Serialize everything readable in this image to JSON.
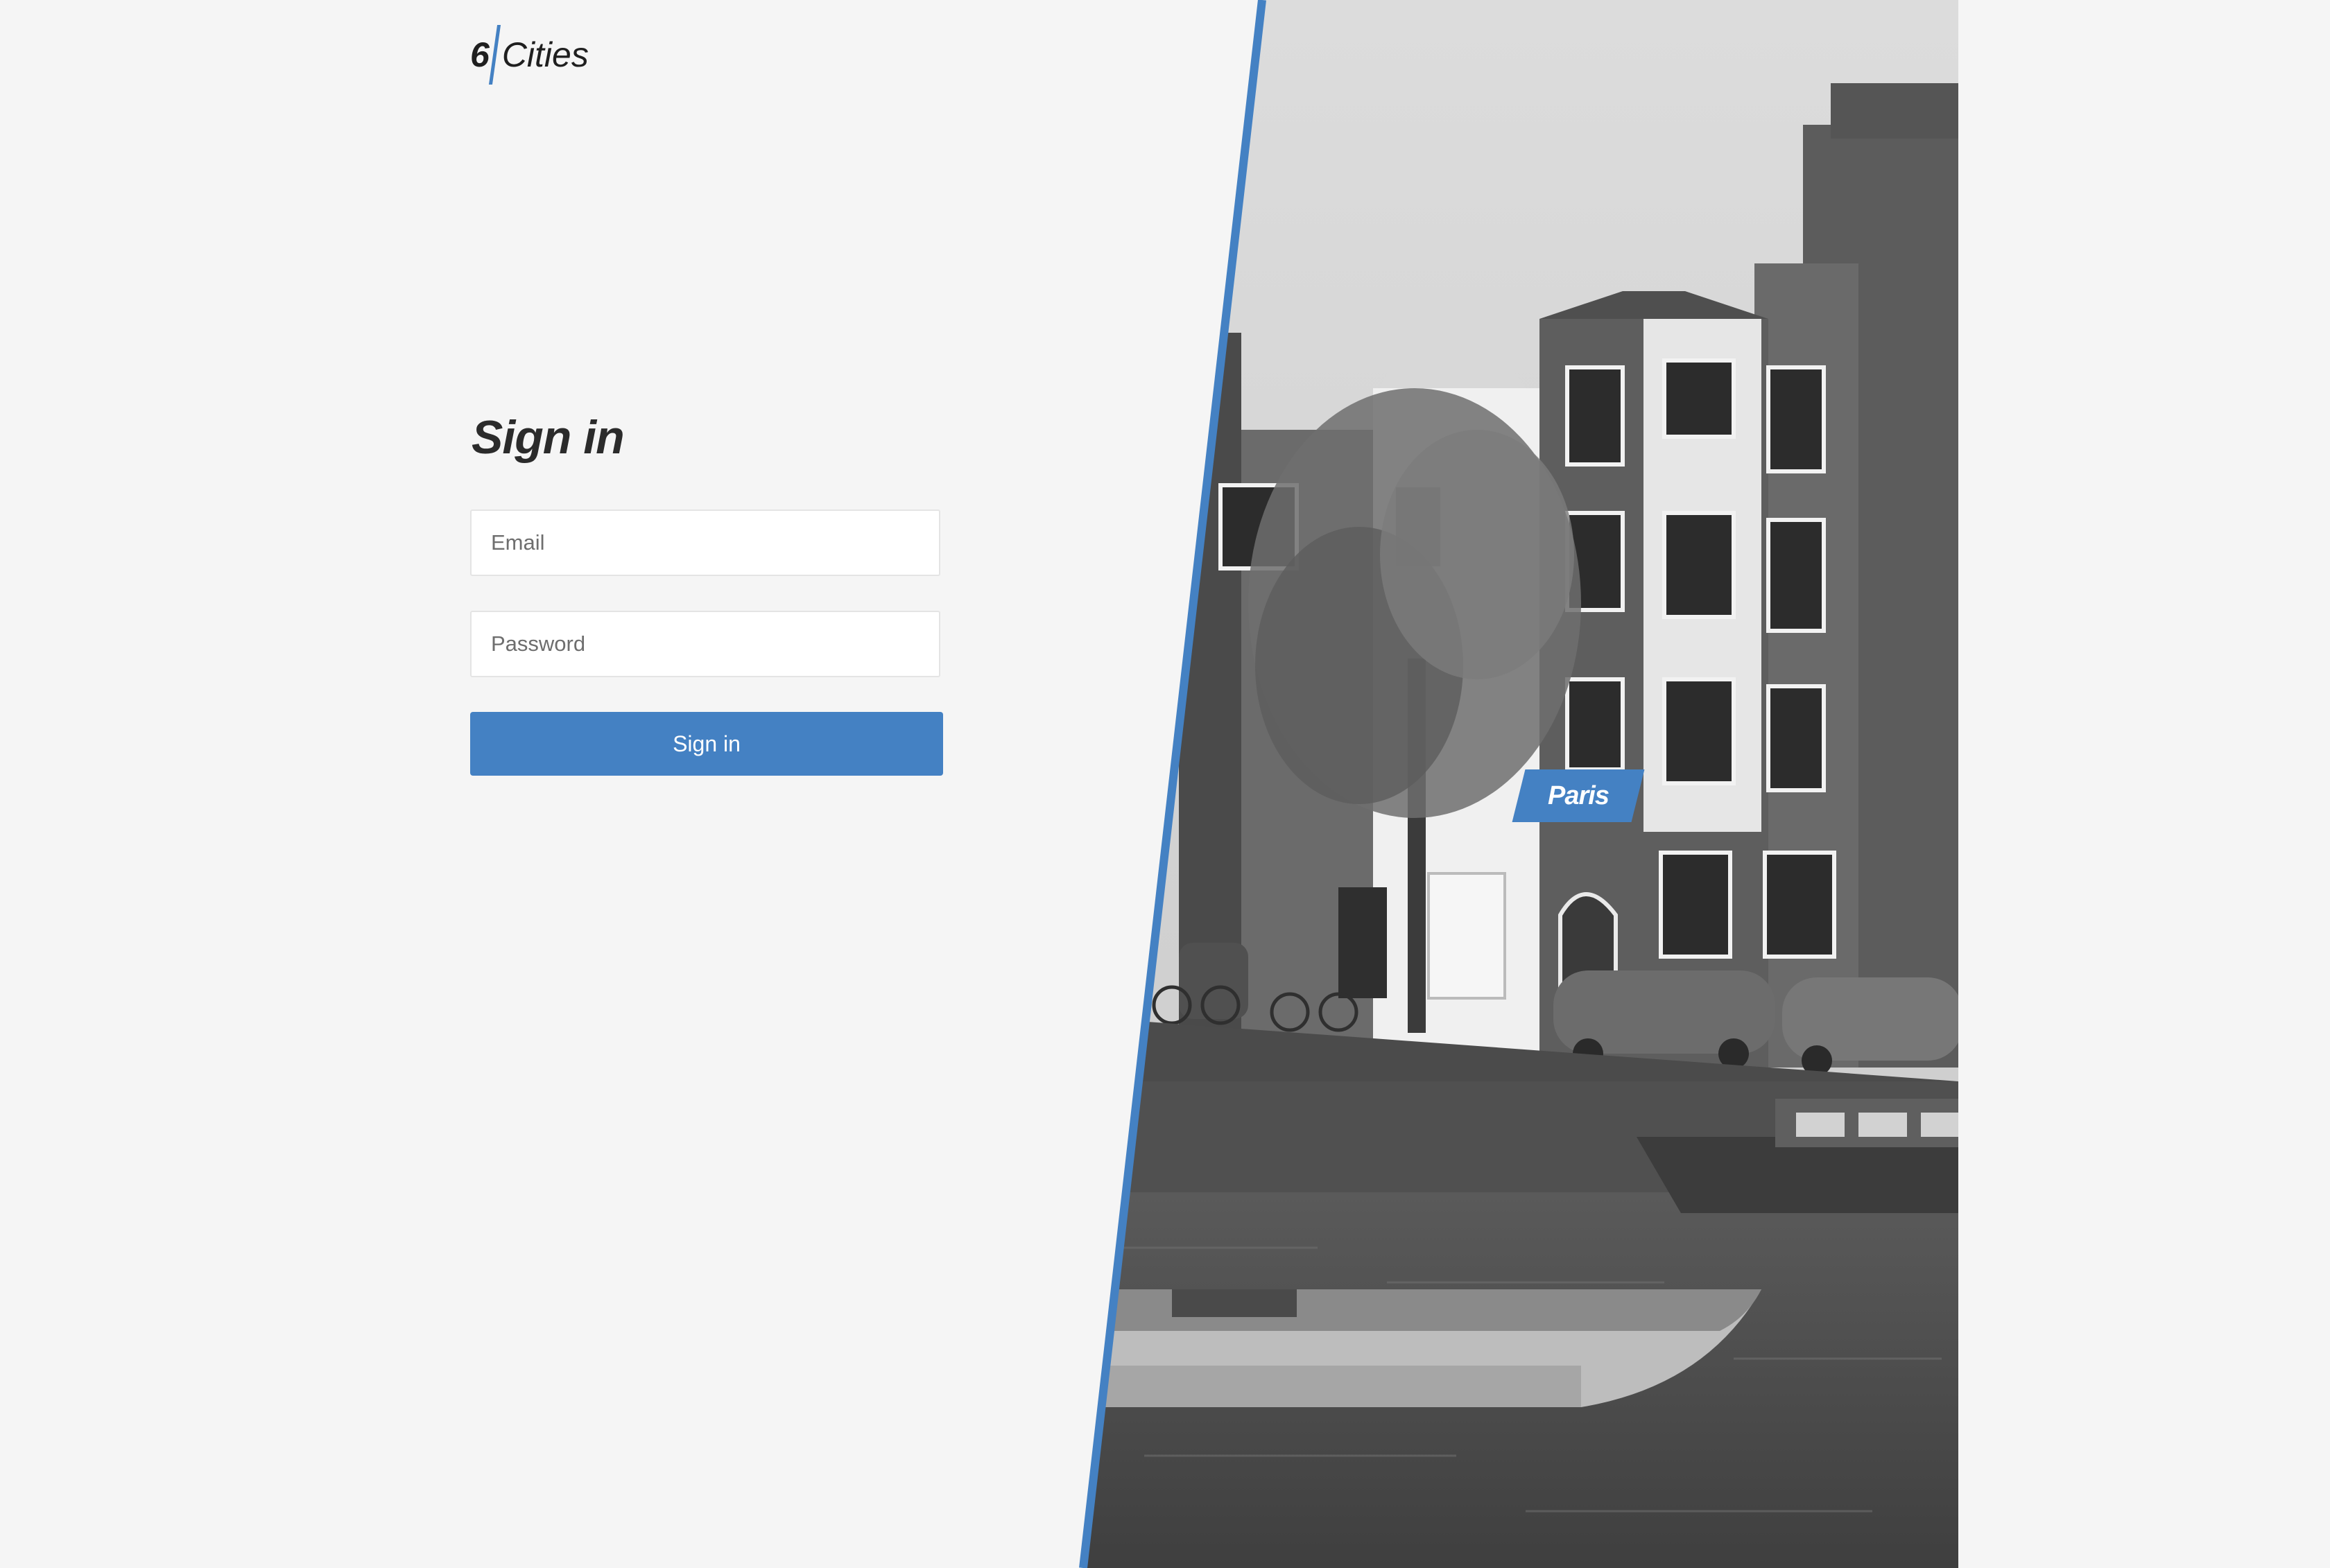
{
  "logo": {
    "number": "6",
    "word": "Cities"
  },
  "signin": {
    "title": "Sign in",
    "email_placeholder": "Email",
    "password_placeholder": "Password",
    "submit_label": "Sign in"
  },
  "promo": {
    "city": "Paris"
  },
  "colors": {
    "accent": "#4481c3",
    "background": "#f5f5f5"
  }
}
